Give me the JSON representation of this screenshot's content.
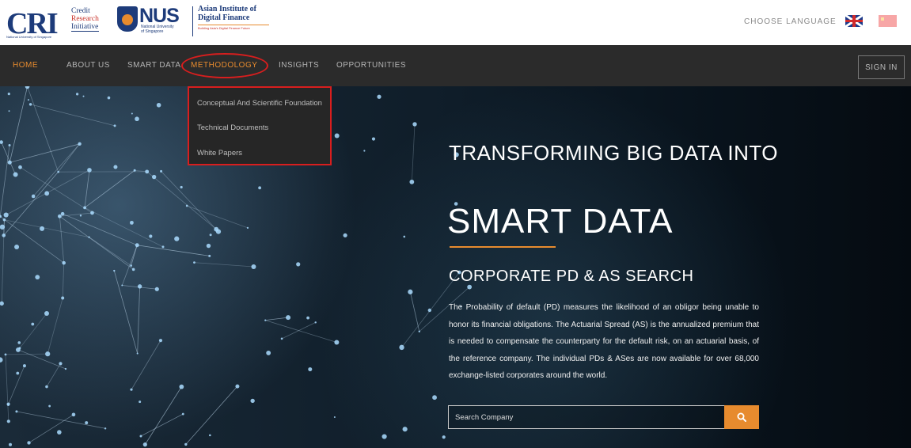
{
  "header": {
    "cri_logo": {
      "letters": "CRI",
      "line1": "Credit",
      "line2": "Research",
      "line3": "Initiative",
      "sub": "National University of Singapore"
    },
    "nus_logo": {
      "big": "NUS",
      "small1": "National University",
      "small2": "of Singapore"
    },
    "aidf_logo": {
      "title1": "Asian Institute of",
      "title2": "Digital Finance",
      "tagline": "Building Asia's Digital Finance Future"
    },
    "choose_language": "CHOOSE LANGUAGE"
  },
  "nav": {
    "items": [
      {
        "label": "HOME"
      },
      {
        "label": "ABOUT US"
      },
      {
        "label": "SMART DATA"
      },
      {
        "label": "METHODOLOGY"
      },
      {
        "label": "INSIGHTS"
      },
      {
        "label": "OPPORTUNITIES"
      }
    ],
    "signin": "SIGN IN"
  },
  "dropdown": {
    "items": [
      {
        "label": "Conceptual And Scientific Foundation"
      },
      {
        "label": "Technical Documents"
      },
      {
        "label": "White Papers"
      }
    ]
  },
  "hero": {
    "line1": "TRANSFORMING BIG DATA INTO",
    "line2": "SMART DATA",
    "subtitle": "CORPORATE PD & AS SEARCH",
    "paragraph": "The Probability of default (PD) measures the likelihood of an obligor being unable to honor its financial obligations. The Actuarial Spread (AS) is the annualized premium that is needed to compensate the counterparty for the default risk, on an actuarial basis, of the reference company. The individual PDs & ASes are now available for over 68,000 exchange-listed corporates around the world.",
    "search_placeholder": "Search Company"
  },
  "colors": {
    "accent": "#e78b2e",
    "nav_bg": "#2b2b2b",
    "highlight": "#d81e1e"
  },
  "icons": [
    "search-icon",
    "uk-flag-icon",
    "china-flag-icon"
  ]
}
